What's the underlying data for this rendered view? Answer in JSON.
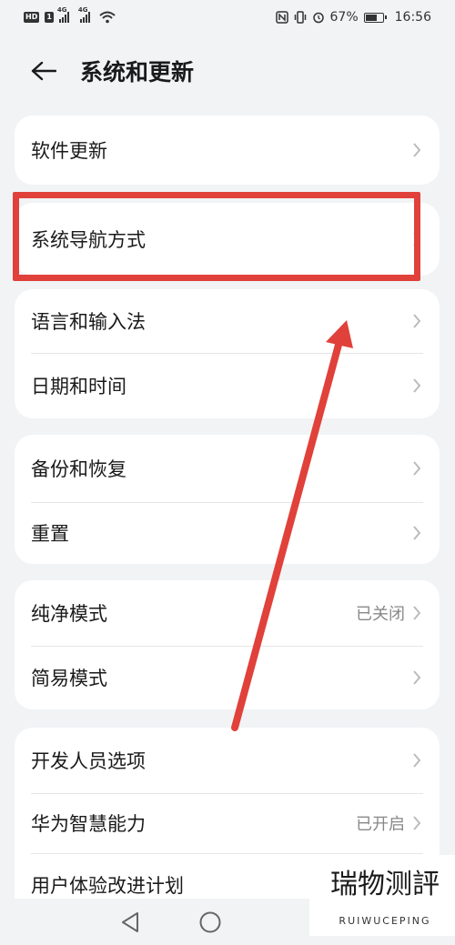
{
  "status_bar": {
    "hd_badge": "HD",
    "sim1": "1",
    "net1": "4G",
    "net2": "4G",
    "battery_percent": "67%",
    "battery_level": 0.67,
    "time": "16:56"
  },
  "header": {
    "title": "系统和更新"
  },
  "groups": [
    {
      "items": [
        {
          "label": "软件更新",
          "value": ""
        }
      ]
    },
    {
      "items": [
        {
          "label": "系统导航方式",
          "value": ""
        }
      ]
    },
    {
      "items": [
        {
          "label": "语言和输入法",
          "value": ""
        },
        {
          "label": "日期和时间",
          "value": ""
        }
      ]
    },
    {
      "items": [
        {
          "label": "备份和恢复",
          "value": ""
        },
        {
          "label": "重置",
          "value": ""
        }
      ]
    },
    {
      "items": [
        {
          "label": "纯净模式",
          "value": "已关闭"
        },
        {
          "label": "简易模式",
          "value": ""
        }
      ]
    },
    {
      "items": [
        {
          "label": "开发人员选项",
          "value": ""
        },
        {
          "label": "华为智慧能力",
          "value": "已开启"
        },
        {
          "label": "用户体验改进计划",
          "value": ""
        }
      ]
    }
  ],
  "watermark": {
    "chars": [
      "瑞",
      "物",
      "测",
      "評"
    ],
    "subtitle": "RUIWUCEPING"
  },
  "colors": {
    "background": "#f1f3f5",
    "card": "#ffffff",
    "annotation": "#e0413a",
    "secondary_text": "#888888"
  }
}
